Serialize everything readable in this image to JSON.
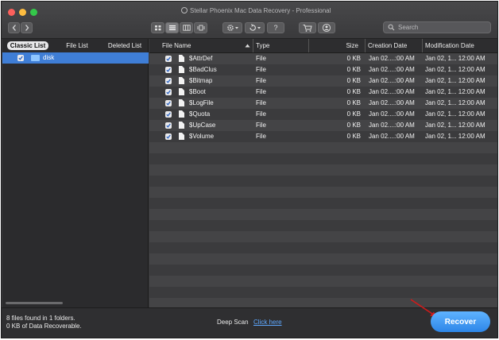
{
  "window": {
    "title": "Stellar Phoenix Mac Data Recovery - Professional"
  },
  "toolbar": {
    "back_icon": "chevron-left",
    "forward_icon": "chevron-right",
    "view_icons": [
      "grid-view",
      "list-view",
      "column-view",
      "coverflow-view"
    ],
    "help_label": "?",
    "search_placeholder": "Search"
  },
  "sidebar": {
    "tabs": [
      "Classic List",
      "File List",
      "Deleted List"
    ],
    "active_tab": "Classic List",
    "tree": [
      {
        "label": "disk",
        "checked": true,
        "selected": true
      }
    ]
  },
  "table": {
    "columns": [
      "File Name",
      "Type",
      "Size",
      "Creation Date",
      "Modification Date"
    ],
    "sort_column": "File Name",
    "rows": [
      {
        "name": "$AttrDef",
        "type": "File",
        "size": "0 KB",
        "created": "Jan 02....:00 AM",
        "modified": "Jan 02, 1... 12:00 AM"
      },
      {
        "name": "$BadClus",
        "type": "File",
        "size": "0 KB",
        "created": "Jan 02....:00 AM",
        "modified": "Jan 02, 1... 12:00 AM"
      },
      {
        "name": "$Bitmap",
        "type": "File",
        "size": "0 KB",
        "created": "Jan 02....:00 AM",
        "modified": "Jan 02, 1... 12:00 AM"
      },
      {
        "name": "$Boot",
        "type": "File",
        "size": "0 KB",
        "created": "Jan 02....:00 AM",
        "modified": "Jan 02, 1... 12:00 AM"
      },
      {
        "name": "$LogFile",
        "type": "File",
        "size": "0 KB",
        "created": "Jan 02....:00 AM",
        "modified": "Jan 02, 1... 12:00 AM"
      },
      {
        "name": "$Quota",
        "type": "File",
        "size": "0 KB",
        "created": "Jan 02....:00 AM",
        "modified": "Jan 02, 1... 12:00 AM"
      },
      {
        "name": "$UpCase",
        "type": "File",
        "size": "0 KB",
        "created": "Jan 02....:00 AM",
        "modified": "Jan 02, 1... 12:00 AM"
      },
      {
        "name": "$Volume",
        "type": "File",
        "size": "0 KB",
        "created": "Jan 02....:00 AM",
        "modified": "Jan 02, 1... 12:00 AM"
      }
    ]
  },
  "status": {
    "files_found": "8 files found in 1 folders.",
    "recoverable": "0 KB of Data Recoverable.",
    "deep_scan_label": "Deep Scan",
    "deep_scan_link": "Click here",
    "recover_label": "Recover"
  },
  "colors": {
    "selection": "#3f7ed6",
    "recover_button": "#3a93f0",
    "annotation_arrow": "#d11a1a"
  }
}
